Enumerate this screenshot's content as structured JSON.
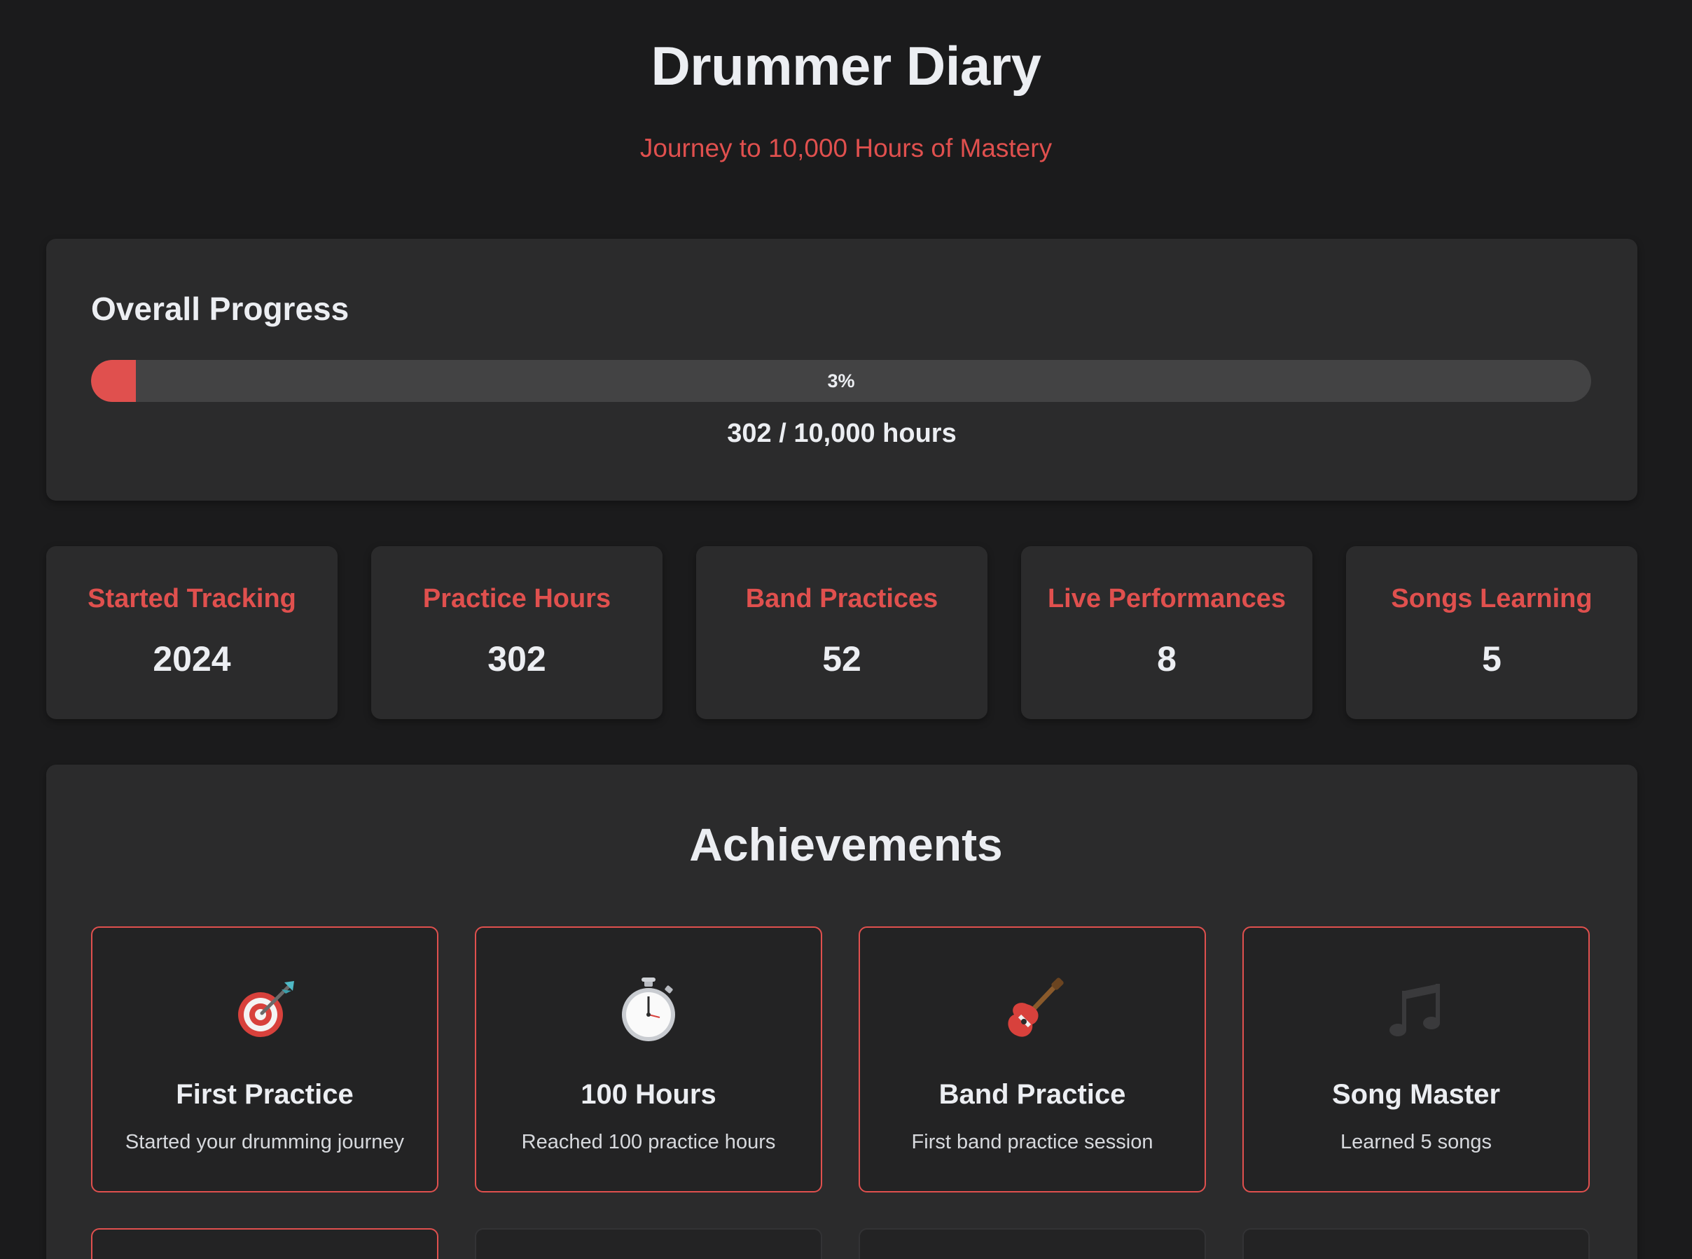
{
  "header": {
    "title": "Drummer Diary",
    "subtitle": "Journey to 10,000 Hours of Mastery"
  },
  "progress": {
    "heading": "Overall Progress",
    "percent_label": "3%",
    "fraction": 0.03,
    "hours_label": "302 / 10,000 hours"
  },
  "stats": [
    {
      "label": "Started Tracking",
      "value": "2024"
    },
    {
      "label": "Practice Hours",
      "value": "302"
    },
    {
      "label": "Band Practices",
      "value": "52"
    },
    {
      "label": "Live Performances",
      "value": "8"
    },
    {
      "label": "Songs Learning",
      "value": "5"
    }
  ],
  "achievements": {
    "heading": "Achievements",
    "items": [
      {
        "icon": "target-icon",
        "title": "First Practice",
        "desc": "Started your drumming journey",
        "unlocked": true
      },
      {
        "icon": "stopwatch-icon",
        "title": "100 Hours",
        "desc": "Reached 100 practice hours",
        "unlocked": true
      },
      {
        "icon": "guitar-icon",
        "title": "Band Practice",
        "desc": "First band practice session",
        "unlocked": true
      },
      {
        "icon": "music-notes-icon",
        "title": "Song Master",
        "desc": "Learned 5 songs",
        "unlocked": true
      }
    ],
    "second_row": [
      {
        "unlocked": true
      },
      {
        "unlocked": false
      },
      {
        "unlocked": false
      },
      {
        "unlocked": false
      }
    ]
  },
  "colors": {
    "accent": "#e0504e",
    "background": "#1b1b1c",
    "card": "#2b2b2c",
    "badge": "#232324"
  }
}
